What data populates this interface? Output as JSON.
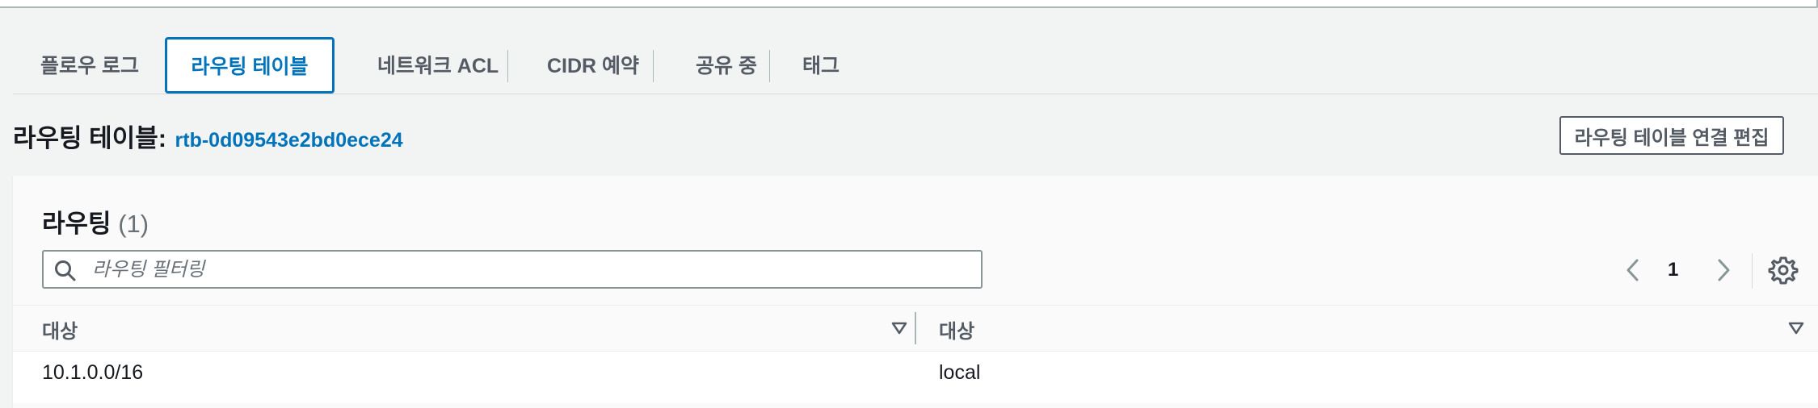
{
  "tabs": [
    {
      "label": "플로우 로그"
    },
    {
      "label": "라우팅 테이블"
    },
    {
      "label": "네트워크 ACL"
    },
    {
      "label": "CIDR 예약"
    },
    {
      "label": "공유 중"
    },
    {
      "label": "태그"
    }
  ],
  "active_tab": "라우팅 테이블",
  "section": {
    "title": "라우팅 테이블:",
    "route_table_id": "rtb-0d09543e2bd0ece24",
    "edit_button": "라우팅 테이블 연결 편집"
  },
  "routes": {
    "title": "라우팅",
    "count": "(1)",
    "search_placeholder": "라우팅 필터링",
    "page": "1",
    "columns": [
      "대상",
      "대상"
    ],
    "rows": [
      {
        "destination": "10.1.0.0/16",
        "target": "local"
      }
    ]
  },
  "colors": {
    "accent": "#0073bb",
    "background": "#f2f3f3",
    "text": "#16191f",
    "muted": "#545b64"
  },
  "icons": [
    "search-icon",
    "chevron-left-icon",
    "chevron-right-icon",
    "settings-gear-icon",
    "sort-caret-down-icon"
  ]
}
